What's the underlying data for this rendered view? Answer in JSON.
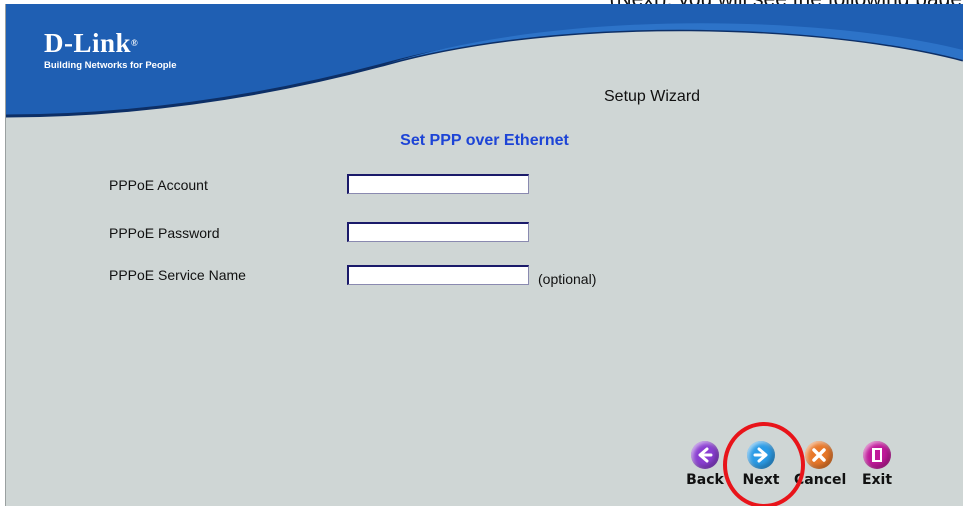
{
  "top_text": "(Next), you will see the following page",
  "logo": {
    "brand": "D-Link",
    "tagline": "Building Networks for People"
  },
  "wizard_title": "Setup Wizard",
  "section_title": "Set PPP over Ethernet",
  "fields": [
    {
      "label": "PPPoE Account",
      "value": ""
    },
    {
      "label": "PPPoE Password",
      "value": ""
    },
    {
      "label": "PPPoE Service Name",
      "value": "",
      "note": "(optional)"
    }
  ],
  "buttons": [
    {
      "label": "Back",
      "icon": "arrow-left-icon",
      "color": "#8a3fd1"
    },
    {
      "label": "Next",
      "icon": "arrow-right-icon",
      "color": "#2b9be6"
    },
    {
      "label": "Cancel",
      "icon": "close-x-icon",
      "color": "#e8782a"
    },
    {
      "label": "Exit",
      "icon": "exit-door-icon",
      "color": "#c0199a"
    }
  ],
  "colors": {
    "header_blue": "#1f5fb3",
    "panel_bg": "#cfd6d5",
    "title_blue": "#1d44d6",
    "highlight": "#e8141a"
  }
}
